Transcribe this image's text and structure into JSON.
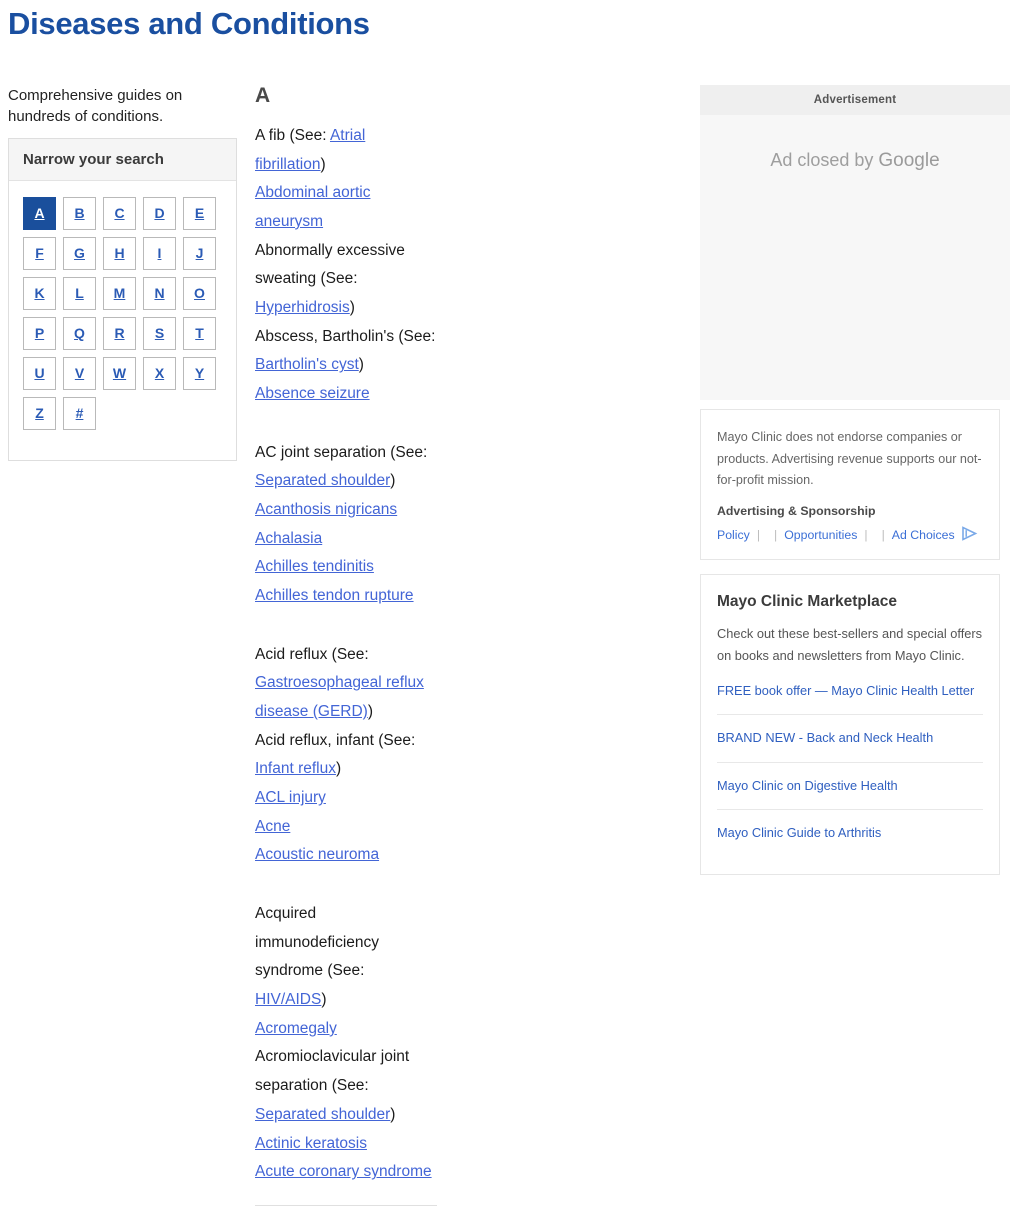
{
  "page": {
    "title": "Diseases and Conditions"
  },
  "left": {
    "intro": "Comprehensive guides on hundreds of conditions.",
    "panel_header": "Narrow your search",
    "letters": [
      {
        "label": "A",
        "active": true
      },
      {
        "label": "B",
        "active": false
      },
      {
        "label": "C",
        "active": false
      },
      {
        "label": "D",
        "active": false
      },
      {
        "label": "E",
        "active": false
      },
      {
        "label": "F",
        "active": false
      },
      {
        "label": "G",
        "active": false
      },
      {
        "label": "H",
        "active": false
      },
      {
        "label": "I",
        "active": false
      },
      {
        "label": "J",
        "active": false
      },
      {
        "label": "K",
        "active": false
      },
      {
        "label": "L",
        "active": false
      },
      {
        "label": "M",
        "active": false
      },
      {
        "label": "N",
        "active": false
      },
      {
        "label": "O",
        "active": false
      },
      {
        "label": "P",
        "active": false
      },
      {
        "label": "Q",
        "active": false
      },
      {
        "label": "R",
        "active": false
      },
      {
        "label": "S",
        "active": false
      },
      {
        "label": "T",
        "active": false
      },
      {
        "label": "U",
        "active": false
      },
      {
        "label": "V",
        "active": false
      },
      {
        "label": "W",
        "active": false
      },
      {
        "label": "X",
        "active": false
      },
      {
        "label": "Y",
        "active": false
      },
      {
        "label": "Z",
        "active": false
      },
      {
        "label": "#",
        "active": false
      }
    ]
  },
  "main": {
    "letter_heading": "A",
    "groups": [
      {
        "entries": [
          {
            "prefix": "A fib (See: ",
            "link": "Atrial fibrillation",
            "suffix": ")"
          },
          {
            "prefix": "",
            "link": "Abdominal aortic aneurysm",
            "suffix": ""
          },
          {
            "prefix": "Abnormally excessive sweating (See: ",
            "link": "Hyperhidrosis",
            "suffix": ")"
          },
          {
            "prefix": "Abscess, Bartholin's (See: ",
            "link": "Bartholin's cyst",
            "suffix": ")"
          },
          {
            "prefix": "",
            "link": "Absence seizure",
            "suffix": ""
          }
        ]
      },
      {
        "entries": [
          {
            "prefix": "AC joint separation (See: ",
            "link": "Separated shoulder",
            "suffix": ")"
          },
          {
            "prefix": "",
            "link": "Acanthosis nigricans",
            "suffix": ""
          },
          {
            "prefix": "",
            "link": "Achalasia",
            "suffix": ""
          },
          {
            "prefix": "",
            "link": "Achilles tendinitis",
            "suffix": ""
          },
          {
            "prefix": "",
            "link": "Achilles tendon rupture",
            "suffix": ""
          }
        ]
      },
      {
        "entries": [
          {
            "prefix": "Acid reflux (See: ",
            "link": "Gastroesophageal reflux disease (GERD)",
            "suffix": ")"
          },
          {
            "prefix": "Acid reflux, infant (See: ",
            "link": "Infant reflux",
            "suffix": ")"
          },
          {
            "prefix": "",
            "link": "ACL injury",
            "suffix": ""
          },
          {
            "prefix": "",
            "link": "Acne",
            "suffix": ""
          },
          {
            "prefix": "",
            "link": "Acoustic neuroma",
            "suffix": ""
          }
        ]
      },
      {
        "entries": [
          {
            "prefix": "Acquired immunodeficiency syndrome (See: ",
            "link": "HIV/AIDS",
            "suffix": ")"
          },
          {
            "prefix": "",
            "link": "Acromegaly",
            "suffix": ""
          },
          {
            "prefix": "Acromioclavicular joint separation (See: ",
            "link": "Separated shoulder",
            "suffix": ")"
          },
          {
            "prefix": "",
            "link": "Actinic keratosis",
            "suffix": ""
          },
          {
            "prefix": "",
            "link": "Acute coronary syndrome",
            "suffix": ""
          }
        ]
      }
    ]
  },
  "ad": {
    "header_label": "Advertisement",
    "closed_text": "Ad closed by ",
    "closed_brand": "Google"
  },
  "disclaimer": {
    "text": "Mayo Clinic does not endorse companies or products. Advertising revenue supports our not-for-profit mission.",
    "subtitle": "Advertising & Sponsorship",
    "links": [
      "Policy",
      "Opportunities",
      "Ad Choices"
    ],
    "separator": "|"
  },
  "marketplace": {
    "title": "Mayo Clinic Marketplace",
    "description": "Check out these best-sellers and special offers on books and newsletters from Mayo Clinic.",
    "links": [
      "FREE book offer — Mayo Clinic Health Letter",
      "BRAND NEW - Back and Neck Health",
      "Mayo Clinic on Digestive Health",
      "Mayo Clinic Guide to Arthritis"
    ]
  },
  "colors": {
    "title_blue": "#1a4fa0",
    "active_letter_bg": "#1a4f9c",
    "link_blue": "#4365d6",
    "sidebar_link_blue": "#2f5fc0"
  }
}
